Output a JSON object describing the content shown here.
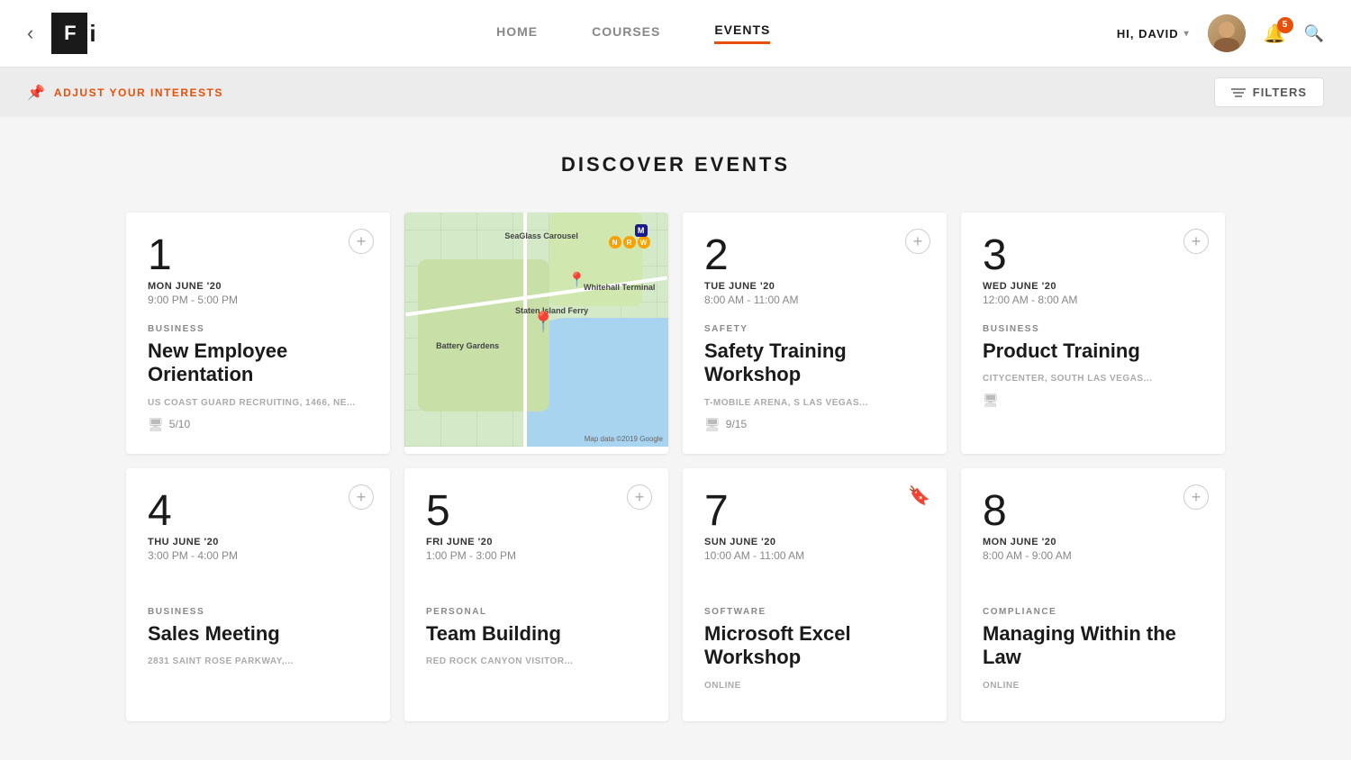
{
  "header": {
    "back_label": "‹",
    "logo_icon": "F",
    "logo_suffix": "i",
    "nav": {
      "home": "HOME",
      "courses": "COURSES",
      "events": "EVENTS"
    },
    "user_greeting": "HI, DAVID",
    "notification_count": "5",
    "active_nav": "EVENTS"
  },
  "subheader": {
    "adjust_interests": "ADJUST YOUR INTERESTS",
    "filters_label": "FILTERS"
  },
  "page": {
    "title": "DISCOVER EVENTS"
  },
  "events": [
    {
      "number": "1",
      "date": "MON JUNE '20",
      "time": "9:00 PM - 5:00 PM",
      "category": "BUSINESS",
      "title": "New Employee Orientation",
      "location": "US COAST GUARD RECRUITING, 1466, NE...",
      "seats": "5/10",
      "has_map": true,
      "bookmarked": false
    },
    {
      "number": "2",
      "date": "TUE JUNE '20",
      "time": "8:00 AM - 11:00 AM",
      "category": "SAFETY",
      "title": "Safety Training Workshop",
      "location": "T-MOBILE ARENA, S LAS VEGAS...",
      "seats": "9/15",
      "has_map": false,
      "bookmarked": false
    },
    {
      "number": "3",
      "date": "WED JUNE '20",
      "time": "12:00 AM - 8:00 AM",
      "category": "BUSINESS",
      "title": "Product Training",
      "location": "CITYCENTER, SOUTH LAS VEGAS...",
      "seats": "",
      "has_map": false,
      "bookmarked": false
    },
    {
      "number": "4",
      "date": "THU JUNE '20",
      "time": "3:00 PM - 4:00 PM",
      "category": "BUSINESS",
      "title": "Sales Meeting",
      "location": "2831 SAINT ROSE PARKWAY,...",
      "seats": "",
      "has_map": false,
      "bookmarked": false
    },
    {
      "number": "5",
      "date": "FRI JUNE '20",
      "time": "1:00 PM - 3:00 PM",
      "category": "PERSONAL",
      "title": "Team Building",
      "location": "RED ROCK CANYON VISITOR...",
      "seats": "",
      "has_map": false,
      "bookmarked": false
    },
    {
      "number": "7",
      "date": "SUN JUNE '20",
      "time": "10:00 AM - 11:00 AM",
      "category": "SOFTWARE",
      "title": "Microsoft Excel Workshop",
      "location": "ONLINE",
      "seats": "",
      "has_map": false,
      "bookmarked": true
    },
    {
      "number": "8",
      "date": "MON JUNE '20",
      "time": "8:00 AM - 9:00 AM",
      "category": "COMPLIANCE",
      "title": "Managing Within the Law",
      "location": "ONLINE",
      "seats": "",
      "has_map": false,
      "bookmarked": false
    }
  ]
}
